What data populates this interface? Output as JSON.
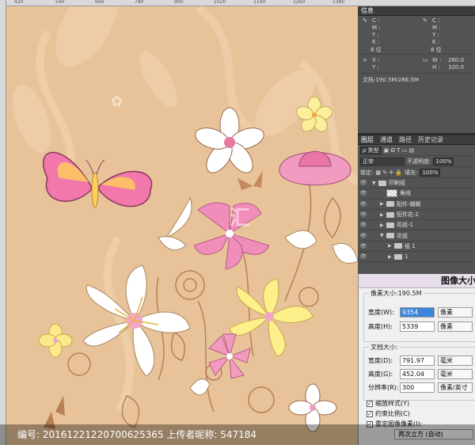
{
  "ruler": {
    "marks": [
      "420",
      "540",
      "660",
      "780",
      "900",
      "1020",
      "1140",
      "1260",
      "1380"
    ]
  },
  "info_panel": {
    "tab": "信息",
    "cmyk_left": [
      "C :",
      "M :",
      "Y :",
      "K :",
      "8 位"
    ],
    "cmyk_right": [
      "C :",
      "M :",
      "Y :",
      "K :",
      "8 位"
    ],
    "x_label": "X :",
    "y_label": "Y :",
    "w_label": "W :",
    "w_value": "260.0",
    "h_label": "H :",
    "h_value": "320.0",
    "doc_size": "文档:190.5M/286.5M"
  },
  "layers_panel": {
    "tabs": [
      "图层",
      "通道",
      "路径",
      "历史记录"
    ],
    "filter_kind": "ρ 类型",
    "blend_mode": "正常",
    "opacity_label": "不透明度:",
    "opacity_value": "100%",
    "lock_label": "锁定:",
    "fill_label": "填充:",
    "fill_value": "100%",
    "layers": [
      {
        "name": "印刷组",
        "kind": "folder",
        "indent": 0,
        "expanded": true
      },
      {
        "name": "角线",
        "kind": "layer",
        "indent": 1,
        "expanded": false
      },
      {
        "name": "配件-蝴蝶",
        "kind": "folder",
        "indent": 1,
        "expanded": false
      },
      {
        "name": "配件花-2",
        "kind": "folder",
        "indent": 1,
        "expanded": false
      },
      {
        "name": "花组-1",
        "kind": "folder",
        "indent": 1,
        "expanded": false
      },
      {
        "name": "花组",
        "kind": "folder",
        "indent": 1,
        "expanded": true
      },
      {
        "name": "组 1",
        "kind": "folder",
        "indent": 2,
        "expanded": false
      },
      {
        "name": "1",
        "kind": "folder",
        "indent": 2,
        "expanded": false
      }
    ]
  },
  "dialog": {
    "title": "图像大小",
    "pixel_size": "像素大小:190.5M",
    "width_label": "宽度(W):",
    "width_value": "9354",
    "width_unit": "像素",
    "height_label": "高度(H):",
    "height_value": "5339",
    "height_unit": "像素",
    "doc_size_label": "文档大小:",
    "doc_width_label": "宽度(D):",
    "doc_width_value": "791.97",
    "doc_width_unit": "毫米",
    "doc_height_label": "高度(G):",
    "doc_height_value": "452.04",
    "doc_height_unit": "毫米",
    "resolution_label": "分辨率(R):",
    "resolution_value": "300",
    "resolution_unit": "像素/英寸",
    "scale_styles": "缩放样式(Y)",
    "constrain": "约束比例(C)",
    "resample": "重定图像像素(I):",
    "resample_method": "两次立方 (自动)"
  },
  "watermark": {
    "text": "编号: 20161221220700625365 上传者昵称: 547184"
  }
}
